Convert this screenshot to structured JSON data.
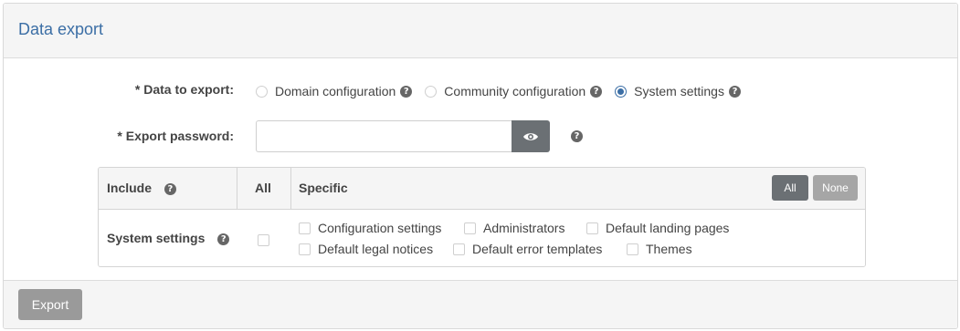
{
  "panel": {
    "title": "Data export",
    "export_button": "Export"
  },
  "form": {
    "data_to_export_label": "* Data to export:",
    "radios": [
      {
        "label": "Domain configuration",
        "checked": false
      },
      {
        "label": "Community configuration",
        "checked": false
      },
      {
        "label": "System settings",
        "checked": true
      }
    ],
    "export_password_label": "* Export password:",
    "export_password_value": "",
    "help_glyph": "?"
  },
  "grid": {
    "col_include": "Include",
    "col_all": "All",
    "col_specific": "Specific",
    "all_button": "All",
    "none_button": "None",
    "row_label": "System settings",
    "options": [
      "Configuration settings",
      "Administrators",
      "Default landing pages",
      "Default legal notices",
      "Default error templates",
      "Themes"
    ]
  },
  "colors": {
    "accent": "#3b6ea5",
    "dark_button": "#6b7074",
    "disabled_button": "#9a9a9a"
  },
  "icons": {
    "help": "question-circle-icon",
    "password_toggle": "eye-icon"
  }
}
